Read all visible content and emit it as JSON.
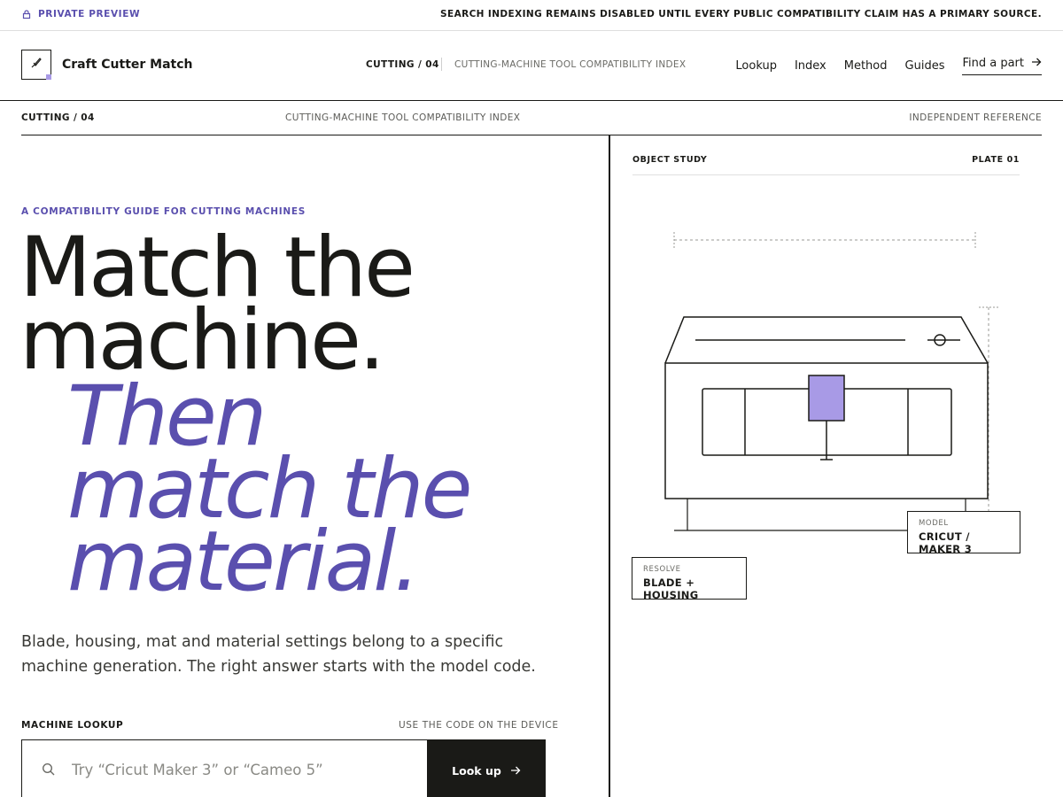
{
  "notice": {
    "left_label": "PRIVATE PREVIEW",
    "left_icon": "lock-icon",
    "right_text": "SEARCH INDEXING REMAINS DISABLED UNTIL EVERY PUBLIC COMPATIBILITY CLAIM HAS A PRIMARY SOURCE."
  },
  "header": {
    "brand": "Craft Cutter Match",
    "logo_icon": "cutter-blade-icon",
    "section_code": "CUTTING / 04",
    "section_title": "CUTTING-MACHINE TOOL COMPATIBILITY INDEX",
    "nav": [
      {
        "label": "Lookup"
      },
      {
        "label": "Index"
      },
      {
        "label": "Method"
      },
      {
        "label": "Guides"
      }
    ],
    "cta": {
      "label": "Find a part",
      "icon": "arrow-right-icon"
    }
  },
  "subbar": {
    "left": "CUTTING / 04",
    "center": "CUTTING-MACHINE TOOL COMPATIBILITY INDEX",
    "right": "INDEPENDENT REFERENCE"
  },
  "hero": {
    "eyebrow": "A COMPATIBILITY GUIDE FOR CUTTING MACHINES",
    "line1": "Match the",
    "line2": "machine.",
    "line3": "Then",
    "line4": "match the",
    "line5": "material.",
    "lede": "Blade, housing, mat and material settings belong to a specific machine generation. The right answer starts with the model code."
  },
  "lookup": {
    "label": "MACHINE LOOKUP",
    "hint": "USE THE CODE ON THE DEVICE",
    "placeholder": "Try “Cricut Maker 3” or “Cameo 5”",
    "value": "",
    "button": "Look up",
    "search_icon": "search-icon",
    "button_icon": "arrow-right-icon"
  },
  "object_study": {
    "label": "OBJECT STUDY",
    "plate": "PLATE 01",
    "model_key": "MODEL",
    "model_value": "CRICUT / MAKER 3",
    "resolve_key": "RESOLVE",
    "resolve_value": "BLADE + HOUSING"
  },
  "colors": {
    "ink": "#1a1a17",
    "accent": "#5a4fae",
    "accent_light": "#a89ae6",
    "rule": "#dedede"
  }
}
